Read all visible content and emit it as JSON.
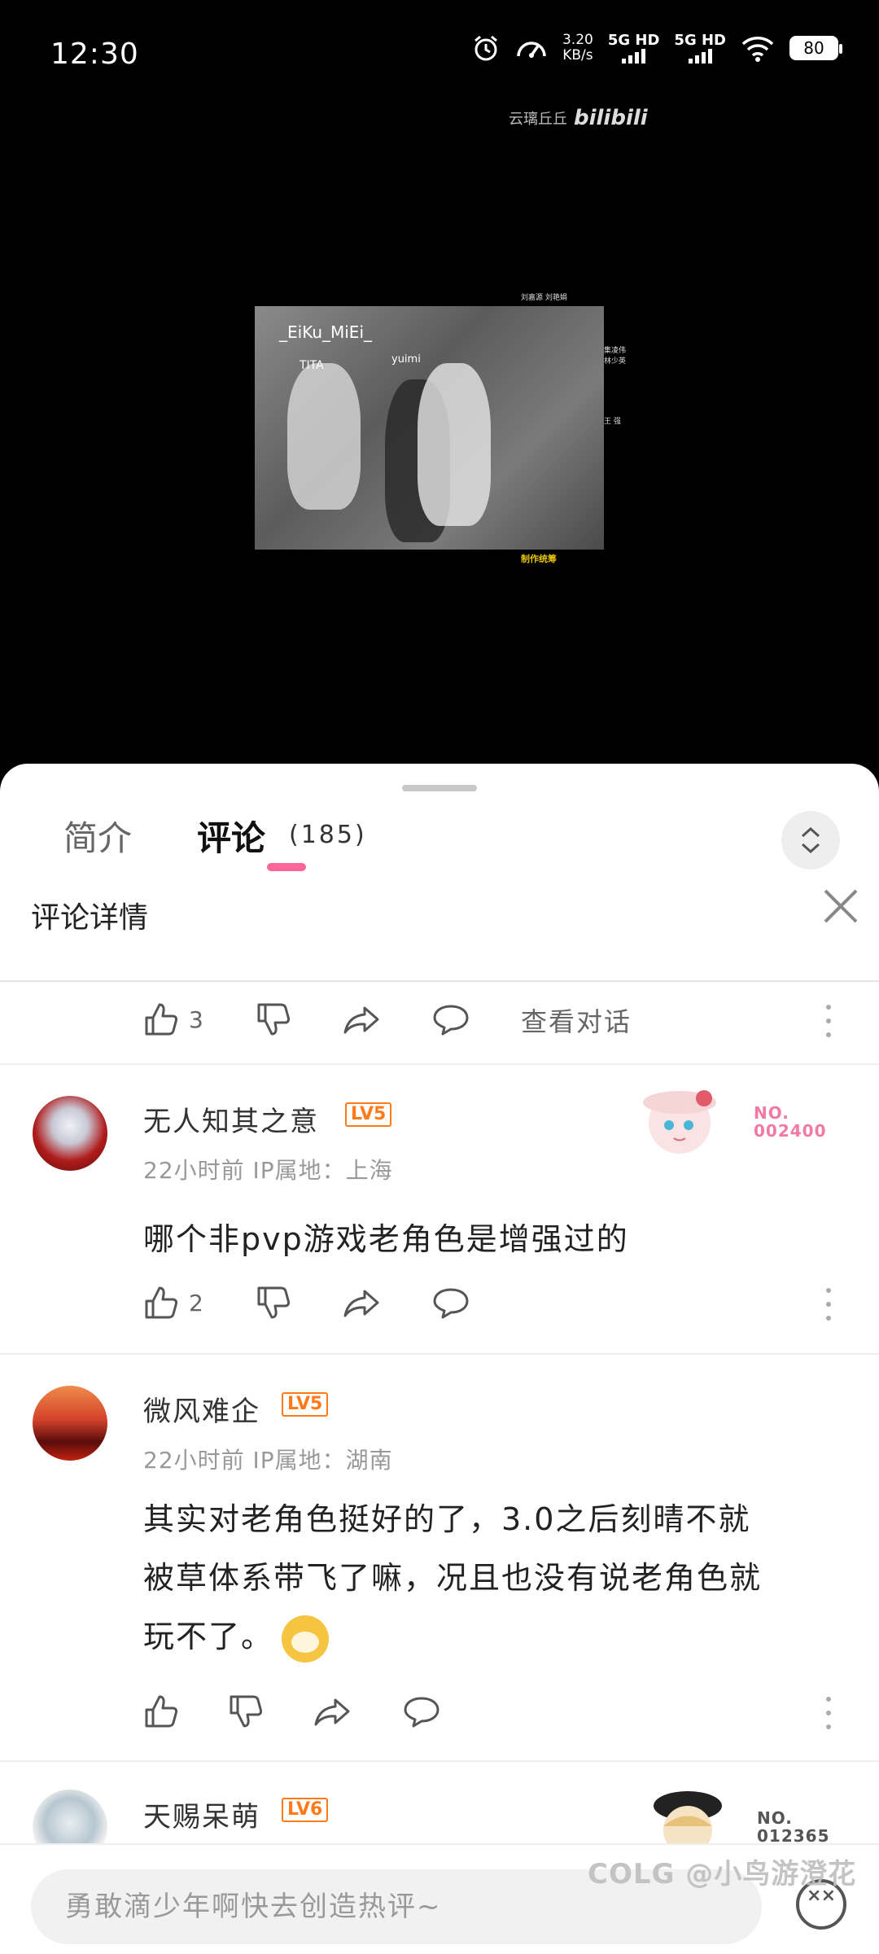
{
  "status_bar": {
    "time": "12:30",
    "net_speed_value": "3.20",
    "net_speed_unit": "KB/s",
    "signal_1": "5G HD",
    "signal_2": "5G HD",
    "battery": "80",
    "icons": [
      "alarm-icon",
      "speedometer-icon",
      "wifi-icon",
      "battery-icon"
    ]
  },
  "video": {
    "watermark_text": "云璃丘丘",
    "watermark_logo": "bilibili",
    "overlay_name": "_EiKu_MiEi_",
    "overlay_sub": "TITA",
    "overlay_sub2": "yuimi",
    "credits_top": "刘嘉源  刘艳娟",
    "credits_side": [
      "集凌伟",
      "林少英"
    ],
    "credits_side2": "王  强",
    "credits_bottom": "制作统筹"
  },
  "tabs": {
    "intro_label": "简介",
    "comments_label": "评论",
    "comments_count": "(185)",
    "accent_color": "#ff6699"
  },
  "detail": {
    "title": "评论详情",
    "close_icon": "close-icon"
  },
  "top_actions": {
    "like_count": "3",
    "view_conversation": "查看对话"
  },
  "comments": [
    {
      "username": "无人知其之意",
      "level": "LV5",
      "meta": "22小时前 IP属地：上海",
      "content": "哪个非pvp游戏老角色是增强过的",
      "like_count": "2",
      "badge_no_label": "NO.",
      "badge_no_value": "002400",
      "badge_color": "#f07aa0"
    },
    {
      "username": "微风难企",
      "level": "LV5",
      "meta": "22小时前 IP属地：湖南",
      "content_line1": "其实对老角色挺好的了，3.0之后刻晴不就",
      "content_line2": "被草体系带飞了嘛，况且也没有说老角色就",
      "content_line3": "玩不了。",
      "like_count": ""
    },
    {
      "username": "天赐呆萌",
      "level": "LV6",
      "badge_no_label": "NO.",
      "badge_no_value": "012365",
      "badge_color": "#555555"
    }
  ],
  "input": {
    "placeholder": "勇敢滴少年啊快去创造热评~"
  },
  "credit_mark": "COLG @小鸟游澄花"
}
